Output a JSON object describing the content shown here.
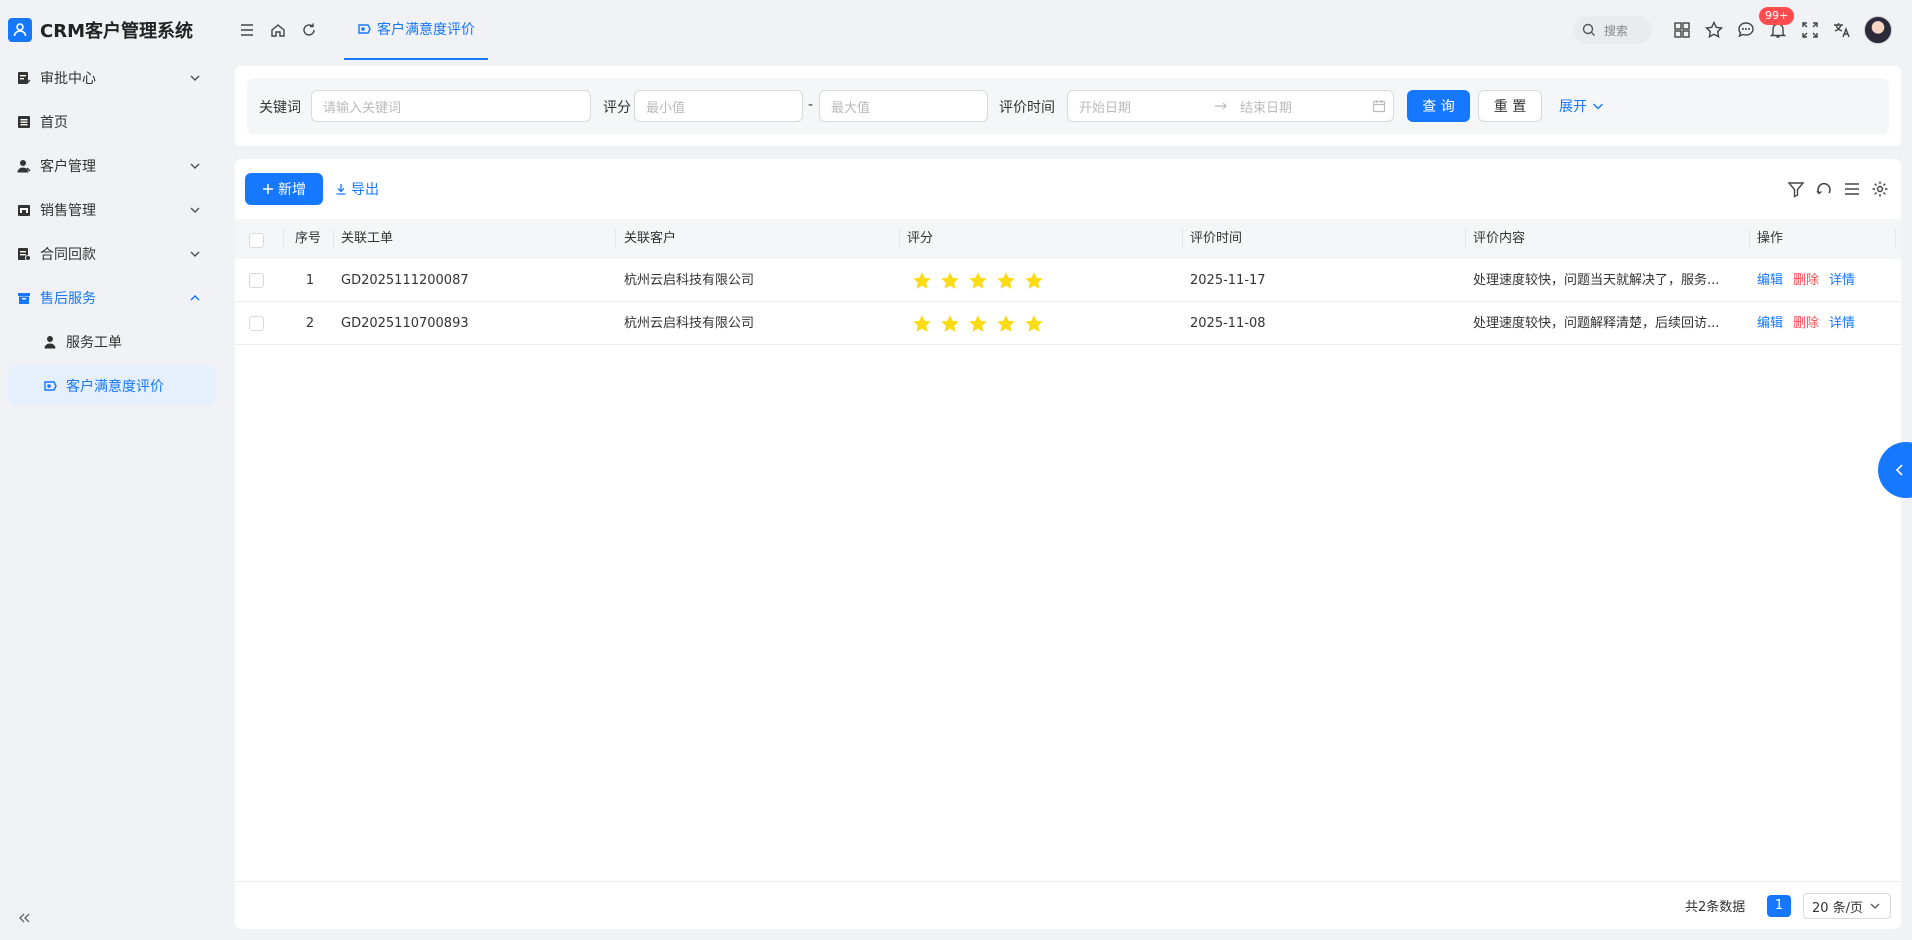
{
  "brand": {
    "title": "CRM客户管理系统"
  },
  "sidebar": {
    "items": [
      {
        "label": "审批中心",
        "icon": "approval-icon",
        "expandable": true
      },
      {
        "label": "首页",
        "icon": "home-doc-icon",
        "expandable": false
      },
      {
        "label": "客户管理",
        "icon": "user-icon",
        "expandable": true
      },
      {
        "label": "销售管理",
        "icon": "shop-icon",
        "expandable": true
      },
      {
        "label": "合同回款",
        "icon": "contract-icon",
        "expandable": true
      },
      {
        "label": "售后服务",
        "icon": "box-icon",
        "expandable": true,
        "open": true
      }
    ],
    "sub_items": [
      {
        "label": "服务工单",
        "icon": "user-icon"
      },
      {
        "label": "客户满意度评价",
        "icon": "rating-icon",
        "active": true
      }
    ]
  },
  "topbar": {
    "active_tab": "客户满意度评价",
    "search_label": "搜索",
    "notification_count": "99+"
  },
  "filter": {
    "keyword_label": "关键词",
    "keyword_placeholder": "请输入关键词",
    "score_label": "评分",
    "min_placeholder": "最小值",
    "range_sep": "-",
    "max_placeholder": "最大值",
    "time_label": "评价时间",
    "start_placeholder": "开始日期",
    "end_placeholder": "结束日期",
    "query_label": "查 询",
    "reset_label": "重 置",
    "expand_label": "展开"
  },
  "toolbar": {
    "add_label": "新增",
    "export_label": "导出"
  },
  "table": {
    "columns": [
      "序号",
      "关联工单",
      "关联客户",
      "评分",
      "评价时间",
      "评价内容",
      "操作"
    ],
    "rows": [
      {
        "index": "1",
        "order": "GD2025111200087",
        "customer": "杭州云启科技有限公司",
        "score": 5,
        "date": "2025-11-17",
        "content": "处理速度较快，问题当天就解决了，服务...",
        "actions": [
          "编辑",
          "删除",
          "详情"
        ]
      },
      {
        "index": "2",
        "order": "GD2025110700893",
        "customer": "杭州云启科技有限公司",
        "score": 5,
        "date": "2025-11-08",
        "content": "处理速度较快，问题解释清楚，后续回访...",
        "actions": [
          "编辑",
          "删除",
          "详情"
        ]
      }
    ]
  },
  "pagination": {
    "total_text": "共2条数据",
    "current_page": "1",
    "page_size": "20 条/页"
  },
  "colors": {
    "primary": "#1677ff",
    "danger": "#ff4d4f",
    "star": "#fadb14"
  }
}
